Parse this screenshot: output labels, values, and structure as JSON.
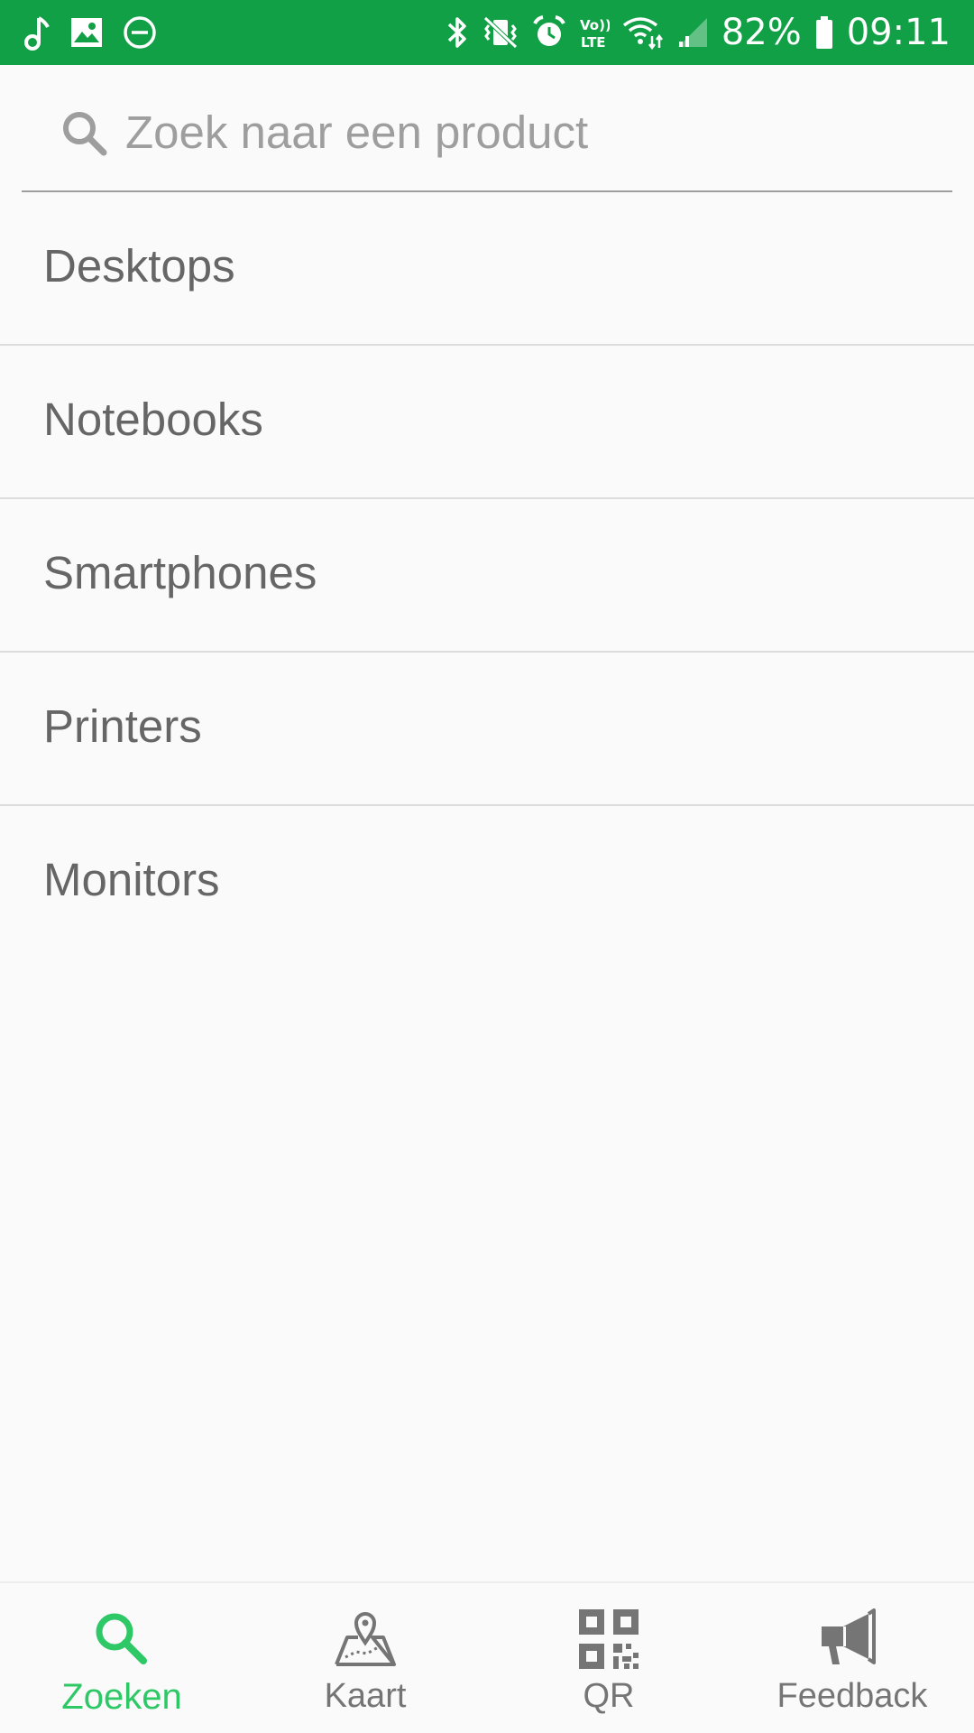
{
  "status_bar": {
    "battery": "82%",
    "time": "09:11",
    "volte_label_top": "Vo))",
    "volte_label_bottom": "LTE",
    "left_icons": [
      "music-note-icon",
      "image-icon",
      "do-not-disturb-icon"
    ],
    "right_icons": [
      "bluetooth-icon",
      "vibrate-icon",
      "alarm-icon",
      "volte-icon",
      "wifi-icon",
      "signal-icon",
      "battery-icon"
    ],
    "background_color": "#12a046"
  },
  "search": {
    "placeholder": "Zoek naar een product",
    "value": ""
  },
  "categories": [
    {
      "label": "Desktops"
    },
    {
      "label": "Notebooks"
    },
    {
      "label": "Smartphones"
    },
    {
      "label": "Printers"
    },
    {
      "label": "Monitors"
    }
  ],
  "bottom_nav": {
    "active_color": "#2ec866",
    "inactive_color": "#757575",
    "items": [
      {
        "label": "Zoeken",
        "icon": "search-icon",
        "active": true
      },
      {
        "label": "Kaart",
        "icon": "map-icon",
        "active": false
      },
      {
        "label": "QR",
        "icon": "qr-code-icon",
        "active": false
      },
      {
        "label": "Feedback",
        "icon": "megaphone-icon",
        "active": false
      }
    ]
  }
}
